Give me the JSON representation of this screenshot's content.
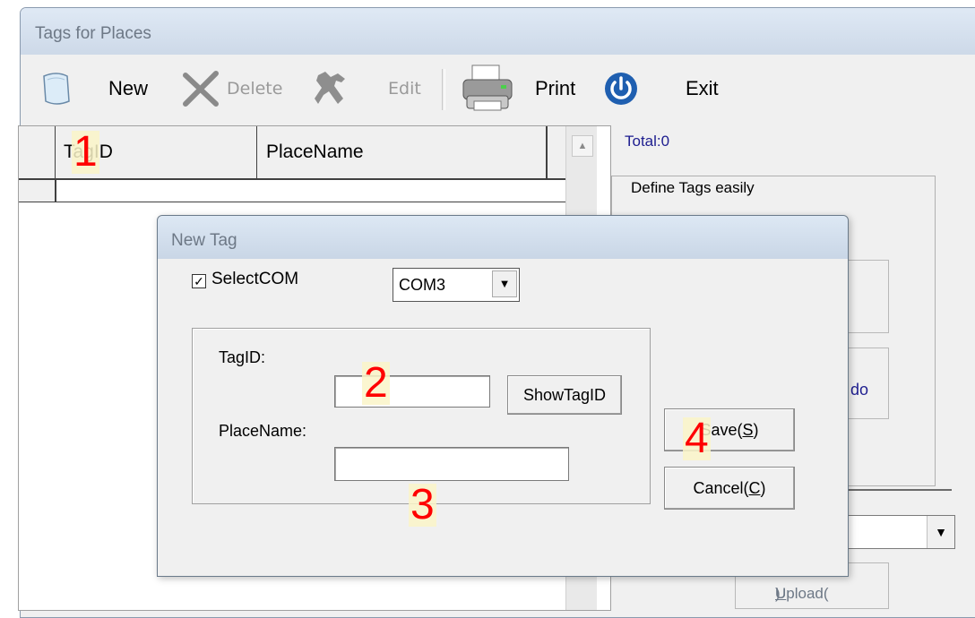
{
  "window": {
    "title": "Tags for Places"
  },
  "toolbar": {
    "new_label": "New",
    "delete_label": "Delete",
    "edit_label": "Edit",
    "print_label": "Print",
    "exit_label": "Exit",
    "icons": [
      "new-document-icon",
      "delete-x-icon",
      "edit-tools-icon",
      "printer-icon",
      "power-icon"
    ]
  },
  "grid": {
    "columns": [
      "TagID",
      "PlaceName"
    ],
    "rows": []
  },
  "right_panel": {
    "total": "Total:0",
    "group_title": "Define Tags easily",
    "button_fragment": "do",
    "upload_label": "Upload(",
    "upload_key": "U",
    "upload_close": ")"
  },
  "dialog": {
    "title": "New Tag",
    "select_com_label": "SelectCOM",
    "select_com_checked": "✓",
    "com_value": "COM3",
    "tagid_label": "TagID:",
    "tagid_value": "",
    "showtagid_label": "ShowTagID",
    "placename_label": "PlaceName:",
    "placename_value": "",
    "save_prefix": "Save(",
    "save_key": "S",
    "save_suffix": ")",
    "cancel_prefix": "Cancel(",
    "cancel_key": "C",
    "cancel_suffix": ")"
  },
  "annotations": [
    "1",
    "2",
    "3",
    "4"
  ],
  "colors": {
    "annotation": "#ff0000",
    "link_text": "#1d1d8f",
    "title_bar": "#cdd9e8"
  }
}
